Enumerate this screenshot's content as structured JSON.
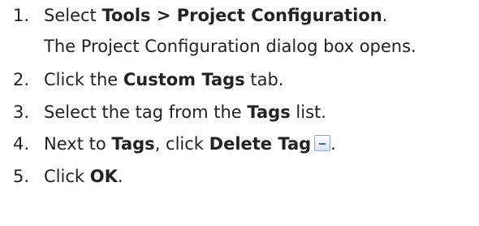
{
  "steps": [
    {
      "number": "1.",
      "parts": [
        "Select ",
        "Tools > Project Configuration",
        "."
      ],
      "sub": "The Project Configuration dialog box opens."
    },
    {
      "number": "2.",
      "parts": [
        "Click the ",
        "Custom Tags",
        " tab."
      ]
    },
    {
      "number": "3.",
      "parts": [
        "Select the tag from the ",
        "Tags",
        " list."
      ]
    },
    {
      "number": "4.",
      "parts": [
        "Next to ",
        "Tags",
        ", click ",
        "Delete Tag",
        "."
      ],
      "icon": "delete-tag-minus-icon"
    },
    {
      "number": "5.",
      "parts": [
        "Click ",
        "OK",
        "."
      ]
    }
  ],
  "colors": {
    "text": "#222222",
    "icon_border": "#8aa8c8",
    "icon_fill": "#d7e3f0",
    "icon_bar": "#4a6f96"
  }
}
